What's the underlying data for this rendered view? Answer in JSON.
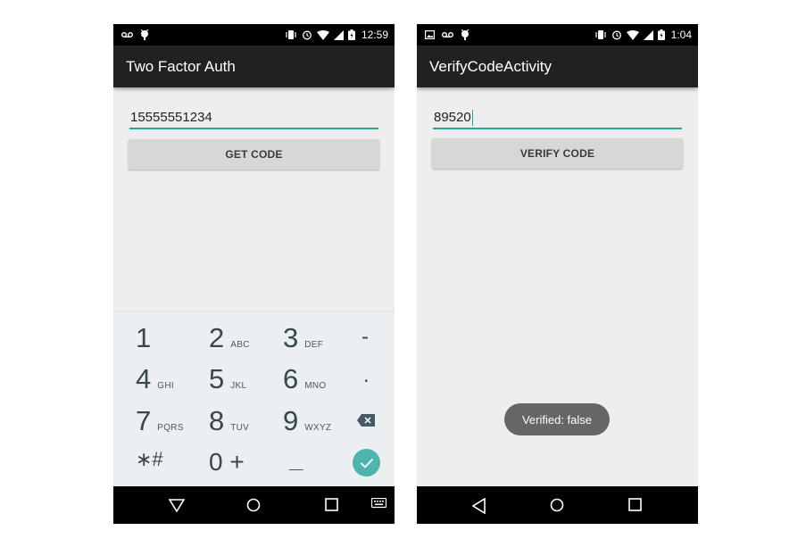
{
  "screen1": {
    "status_time": "12:59",
    "app_title": "Two Factor Auth",
    "phone_value": "15555551234",
    "button_label": "GET CODE",
    "keypad": {
      "rows": [
        [
          {
            "d": "1",
            "l": ""
          },
          {
            "d": "2",
            "l": "ABC"
          },
          {
            "d": "3",
            "l": "DEF"
          },
          {
            "d": "-",
            "l": ""
          }
        ],
        [
          {
            "d": "4",
            "l": "GHI"
          },
          {
            "d": "5",
            "l": "JKL"
          },
          {
            "d": "6",
            "l": "MNO"
          },
          {
            "d": ".",
            "l": ""
          }
        ],
        [
          {
            "d": "7",
            "l": "PQRS"
          },
          {
            "d": "8",
            "l": "TUV"
          },
          {
            "d": "9",
            "l": "WXYZ"
          },
          {
            "d": "backspace-icon",
            "l": ""
          }
        ],
        [
          {
            "d": "∗#",
            "l": ""
          },
          {
            "d": "0 +",
            "l": ""
          },
          {
            "d": "__",
            "l": ""
          },
          {
            "d": "check-icon",
            "l": ""
          }
        ]
      ]
    }
  },
  "screen2": {
    "status_time": "1:04",
    "app_title": "VerifyCodeActivity",
    "code_value": "89520",
    "button_label": "VERIFY CODE",
    "toast": "Verified: false"
  },
  "colors": {
    "accent": "#26a69a",
    "fab": "#4db6ac",
    "appbar": "#212121",
    "background": "#eeeeee",
    "button": "#d6d7d7",
    "toast": "#666666"
  }
}
